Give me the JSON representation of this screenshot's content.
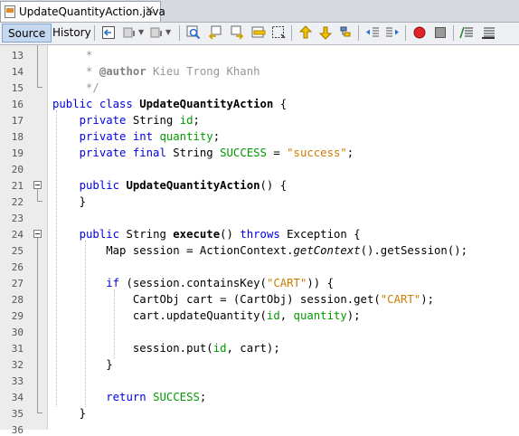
{
  "tab": {
    "title": "UpdateQuantityAction.java",
    "close": "×"
  },
  "toolbar": {
    "source_label": "Source",
    "history_label": "History"
  },
  "colors": {
    "keyword": "#0000e6",
    "string": "#ce7b00",
    "field": "#009900",
    "comment": "#969696"
  },
  "editor": {
    "lines": [
      {
        "n": "13",
        "t": [
          [
            "cm",
            "     *"
          ]
        ]
      },
      {
        "n": "14",
        "t": [
          [
            "cm",
            "     * "
          ],
          [
            "cmb",
            "@author"
          ],
          [
            "cm",
            " Kieu Trong Khanh"
          ]
        ]
      },
      {
        "n": "15",
        "t": [
          [
            "cm",
            "     */"
          ]
        ]
      },
      {
        "n": "16",
        "t": [
          [
            "kw",
            "public class "
          ],
          [
            "bold",
            "UpdateQuantityAction"
          ],
          [
            "",
            " {"
          ]
        ]
      },
      {
        "n": "17",
        "t": [
          [
            "",
            "    "
          ],
          [
            "kw",
            "private "
          ],
          [
            "",
            "String "
          ],
          [
            "fld",
            "id"
          ],
          [
            "",
            ";"
          ]
        ]
      },
      {
        "n": "18",
        "t": [
          [
            "",
            "    "
          ],
          [
            "kw",
            "private int "
          ],
          [
            "fld",
            "quantity"
          ],
          [
            "",
            ";"
          ]
        ]
      },
      {
        "n": "19",
        "t": [
          [
            "",
            "    "
          ],
          [
            "kw",
            "private final "
          ],
          [
            "",
            "String "
          ],
          [
            "fld",
            "SUCCESS"
          ],
          [
            "",
            " = "
          ],
          [
            "str",
            "\"success\""
          ],
          [
            "",
            ";"
          ]
        ]
      },
      {
        "n": "20",
        "t": []
      },
      {
        "n": "21",
        "t": [
          [
            "",
            "    "
          ],
          [
            "kw",
            "public "
          ],
          [
            "bold",
            "UpdateQuantityAction"
          ],
          [
            "",
            "() {"
          ]
        ]
      },
      {
        "n": "22",
        "t": [
          [
            "",
            "    }"
          ]
        ]
      },
      {
        "n": "23",
        "t": []
      },
      {
        "n": "24",
        "t": [
          [
            "",
            "    "
          ],
          [
            "kw",
            "public "
          ],
          [
            "",
            "String "
          ],
          [
            "bold",
            "execute"
          ],
          [
            "",
            "() "
          ],
          [
            "kw",
            "throws "
          ],
          [
            "",
            "Exception {"
          ]
        ]
      },
      {
        "n": "25",
        "t": [
          [
            "",
            "        Map session = ActionContext."
          ],
          [
            "ital",
            "getContext"
          ],
          [
            "",
            "().getSession();"
          ]
        ]
      },
      {
        "n": "26",
        "t": []
      },
      {
        "n": "27",
        "t": [
          [
            "",
            "        "
          ],
          [
            "kw",
            "if "
          ],
          [
            "",
            "(session.containsKey("
          ],
          [
            "str",
            "\"CART\""
          ],
          [
            "",
            ")) {"
          ]
        ]
      },
      {
        "n": "28",
        "t": [
          [
            "",
            "            CartObj cart = (CartObj) session.get("
          ],
          [
            "str",
            "\"CART\""
          ],
          [
            "",
            ");"
          ]
        ]
      },
      {
        "n": "29",
        "t": [
          [
            "",
            "            cart.updateQuantity("
          ],
          [
            "fld",
            "id"
          ],
          [
            "",
            ", "
          ],
          [
            "fld",
            "quantity"
          ],
          [
            "",
            ");"
          ]
        ]
      },
      {
        "n": "30",
        "t": []
      },
      {
        "n": "31",
        "t": [
          [
            "",
            "            session.put("
          ],
          [
            "fld",
            "id"
          ],
          [
            "",
            ", cart);"
          ]
        ]
      },
      {
        "n": "32",
        "t": [
          [
            "",
            "        }"
          ]
        ]
      },
      {
        "n": "33",
        "t": []
      },
      {
        "n": "34",
        "t": [
          [
            "",
            "        "
          ],
          [
            "kw",
            "return "
          ],
          [
            "fld",
            "SUCCESS"
          ],
          [
            "",
            ";"
          ]
        ]
      },
      {
        "n": "35",
        "t": [
          [
            "",
            "    }"
          ]
        ]
      },
      {
        "n": "36",
        "t": []
      }
    ]
  }
}
